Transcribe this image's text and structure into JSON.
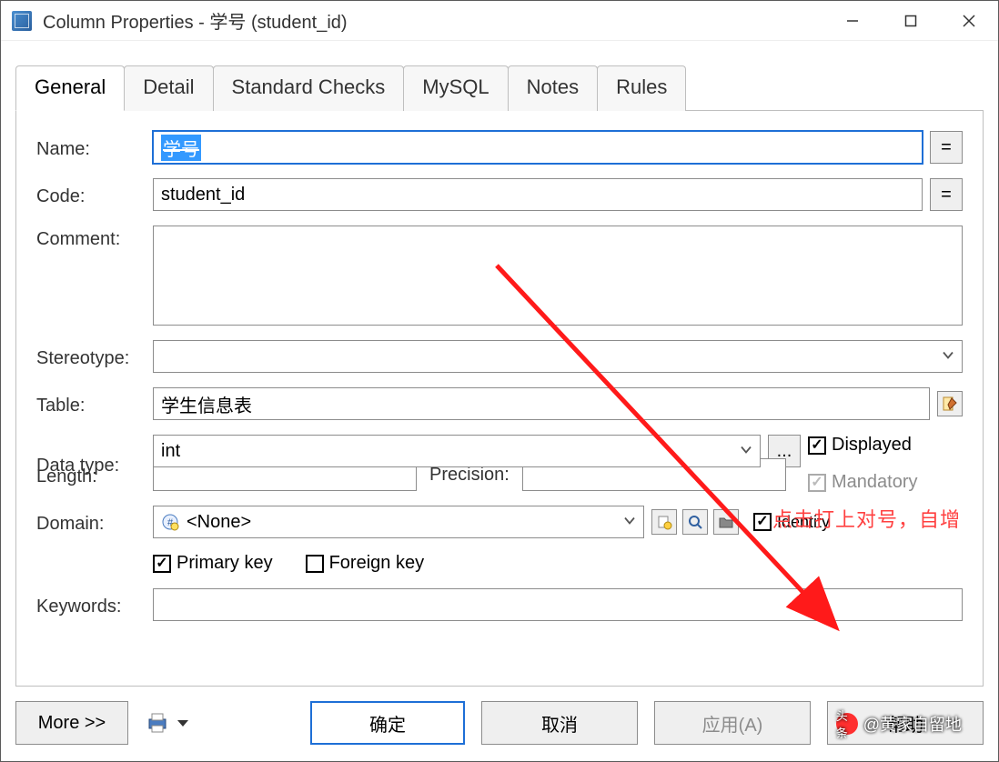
{
  "window": {
    "title": "Column Properties - 学号 (student_id)"
  },
  "tabs": [
    "General",
    "Detail",
    "Standard Checks",
    "MySQL",
    "Notes",
    "Rules"
  ],
  "active_tab_index": 0,
  "labels": {
    "name": "Name:",
    "code": "Code:",
    "comment": "Comment:",
    "stereotype": "Stereotype:",
    "table": "Table:",
    "data_type": "Data type:",
    "length": "Length:",
    "precision": "Precision:",
    "domain": "Domain:",
    "keywords": "Keywords:"
  },
  "values": {
    "name": "学号",
    "code": "student_id",
    "comment": "",
    "stereotype": "",
    "table": "学生信息表",
    "data_type": "int",
    "length": "",
    "precision": "",
    "domain": "<None>",
    "keywords": ""
  },
  "side_buttons": {
    "eq1": "=",
    "eq2": "=",
    "ellipsis": "..."
  },
  "checkboxes": {
    "displayed": {
      "label": "Displayed",
      "checked": true
    },
    "mandatory": {
      "label": "Mandatory",
      "checked": true,
      "disabled": true
    },
    "identity": {
      "label": "Identity",
      "checked": true
    },
    "primary_key": {
      "label": "Primary key",
      "checked": true
    },
    "foreign_key": {
      "label": "Foreign key",
      "checked": false
    }
  },
  "footer": {
    "more": "More >>",
    "ok": "确定",
    "cancel": "取消",
    "apply": "应用(A)",
    "help": "帮助"
  },
  "annotation": "点击打上对号，自增",
  "watermark": {
    "badge": "头条",
    "author": "@黄家自留地"
  }
}
